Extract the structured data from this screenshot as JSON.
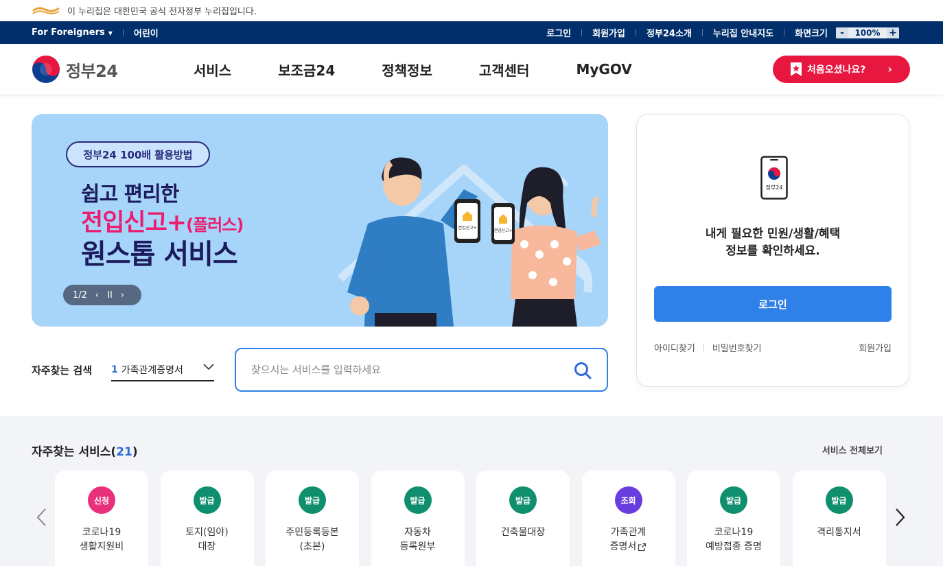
{
  "gov_banner": {
    "text": "이 누리집은 대한민국 공식 전자정부 누리집입니다."
  },
  "util_bar": {
    "for_foreigners": "For Foreigners",
    "kids": "어린이",
    "login": "로그인",
    "signup": "회원가입",
    "about": "정부24소개",
    "sitemap": "누리집 안내지도",
    "zoom_label": "화면크기",
    "zoom_value": "100%",
    "zoom_minus": "-",
    "zoom_plus": "+"
  },
  "header": {
    "logo_text": "정부24",
    "nav": [
      "서비스",
      "보조금24",
      "정책정보",
      "고객센터",
      "MyGOV"
    ],
    "cta": "처음오셨나요?"
  },
  "banner": {
    "pill": "정부24 100배 활용방법",
    "line1": "쉽고 편리한",
    "line2_main": "전입신고+",
    "line2_small": "(플러스)",
    "line3": "원스톱 서비스",
    "slide_counter": "1/2",
    "phone_label": "전입신고+"
  },
  "login_card": {
    "phone_caption": "정부24",
    "message_line1": "내게 필요한 민원/생활/혜택",
    "message_line2": "정보를 확인하세요.",
    "login_button": "로그인",
    "find_id": "아이디찾기",
    "find_pw": "비밀번호찾기",
    "signup": "회원가입"
  },
  "search": {
    "freq_label": "자주찾는 검색",
    "freq_rank": "1",
    "freq_value": "가족관계증명서",
    "placeholder": "찾으시는 서비스를 입력하세요"
  },
  "services": {
    "title": "자주찾는 서비스(",
    "count": "21",
    "title_end": ")",
    "view_all": "서비스 전체보기",
    "items": [
      {
        "badge": "신청",
        "color": "#e8307c",
        "label": "코로나19\n생활지원비"
      },
      {
        "badge": "발급",
        "color": "#0f8f6e",
        "label": "토지(임야)\n대장"
      },
      {
        "badge": "발급",
        "color": "#0f8f6e",
        "label": "주민등록등본\n(초본)"
      },
      {
        "badge": "발급",
        "color": "#0f8f6e",
        "label": "자동차\n등록원부"
      },
      {
        "badge": "발급",
        "color": "#0f8f6e",
        "label": "건축물대장"
      },
      {
        "badge": "조회",
        "color": "#6a3de0",
        "label": "가족관계\n증명서"
      },
      {
        "badge": "발급",
        "color": "#0f8f6e",
        "label": "코로나19\n예방접종 증명"
      },
      {
        "badge": "발급",
        "color": "#0f8f6e",
        "label": "격리통지서"
      }
    ]
  }
}
